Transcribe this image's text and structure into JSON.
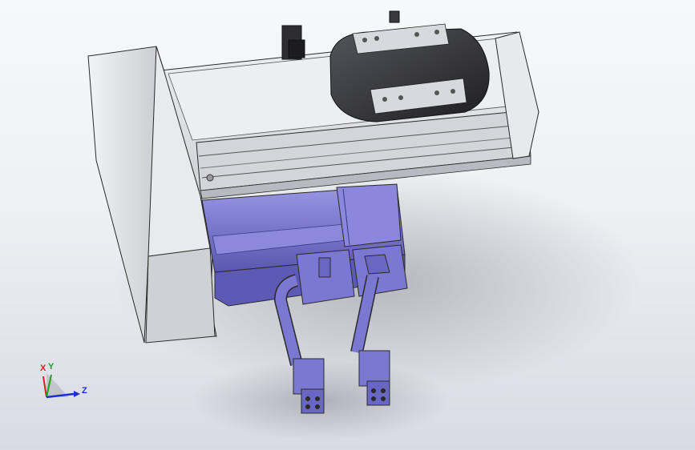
{
  "scene": {
    "colors": {
      "background_top": "#f7f8fa",
      "background_bottom": "#d9dbe3",
      "housing": "#e3e4e8",
      "housing_dark": "#c9cad0",
      "rail": "#dcdde2",
      "motor": "#7b78d2",
      "motor_dark": "#5c59b3",
      "carriage": "#3a3a3e",
      "outline": "#2a2a2a"
    },
    "model": [
      "linear-actuator-housing",
      "end-cap",
      "guide-rail",
      "carriage-slider",
      "servo-motor",
      "motor-connector",
      "power-cable",
      "signal-cable",
      "cable-plug"
    ]
  },
  "triad": {
    "x_label": "X",
    "y_label": "Y",
    "z_label": "Z",
    "x_color": "#d62020",
    "y_color": "#1fa01f",
    "z_color": "#2030d0"
  }
}
